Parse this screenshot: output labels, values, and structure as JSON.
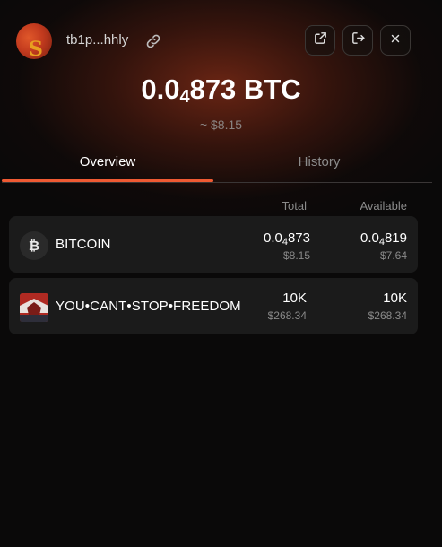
{
  "header": {
    "address": "tb1p...hhly",
    "icons": {
      "copy_link": "link-icon",
      "open_external": "external-link-icon",
      "logout": "logout-icon",
      "close": "close-icon"
    }
  },
  "balance": {
    "lead": "0.0",
    "subscript_zeros": "4",
    "digits": "873",
    "unit": " BTC",
    "fiat": "~ $8.15"
  },
  "tabs": [
    {
      "label": "Overview",
      "active": true
    },
    {
      "label": "History",
      "active": false
    }
  ],
  "table": {
    "columns": {
      "total": "Total",
      "available": "Available"
    },
    "rows": [
      {
        "icon_symbol": "₿",
        "icon_name": "bitcoin-icon",
        "name": "BITCOIN",
        "total": {
          "lead": "0.0",
          "sub": "4",
          "digits": "873"
        },
        "total_fiat": "$8.15",
        "available": {
          "lead": "0.0",
          "sub": "4",
          "digits": "819"
        },
        "available_fiat": "$7.64"
      },
      {
        "icon_name": "rune-token-icon",
        "name": "YOU•CANT•STOP•FREEDOM",
        "total_plain": "10K",
        "total_fiat": "$268.34",
        "available_plain": "10K",
        "available_fiat": "$268.34"
      }
    ]
  },
  "colors": {
    "accent": "#ef5a33",
    "background": "#0a0909",
    "row_background": "#1b1b1b",
    "muted_text": "#8a8a8a"
  }
}
